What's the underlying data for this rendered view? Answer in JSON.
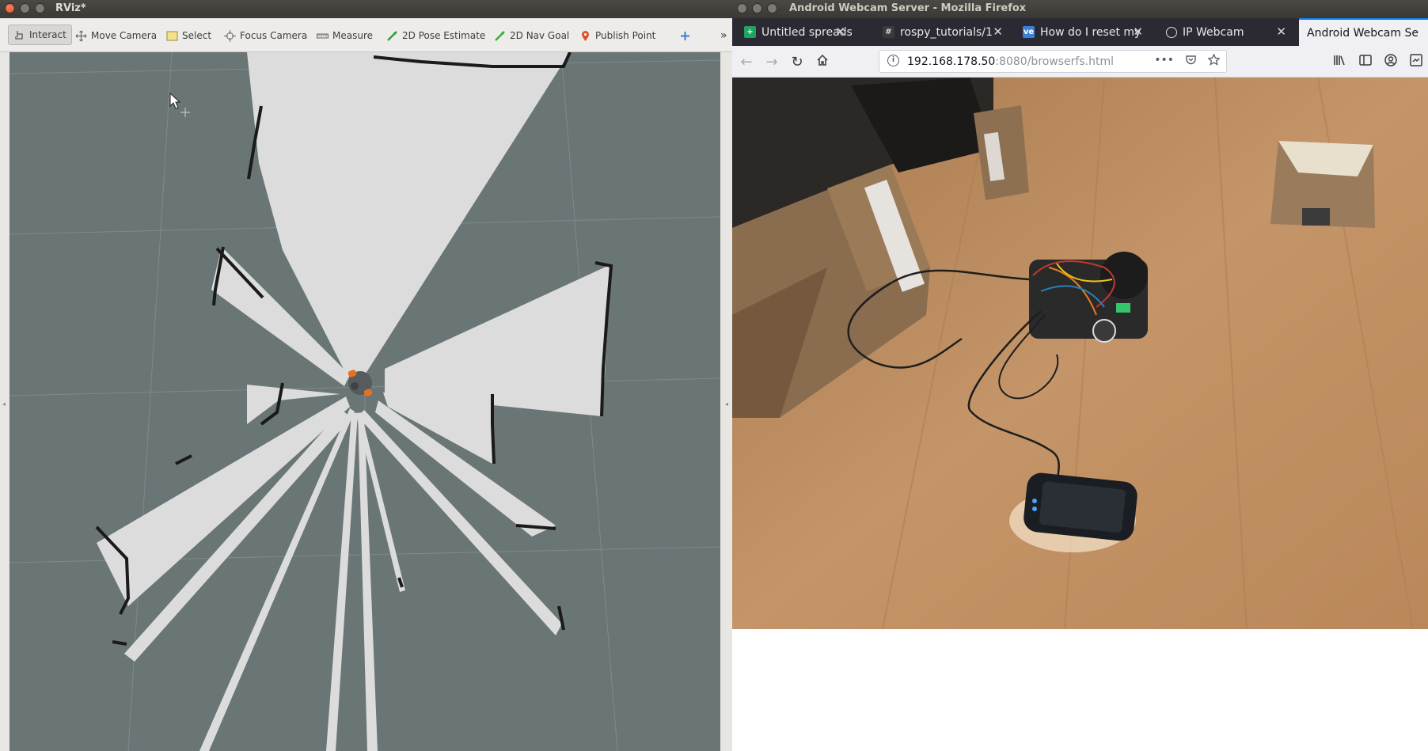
{
  "rviz": {
    "title": "RViz*",
    "tools": [
      {
        "label": "Interact",
        "icon": "interact-icon"
      },
      {
        "label": "Move Camera",
        "icon": "move-camera-icon"
      },
      {
        "label": "Select",
        "icon": "select-icon"
      },
      {
        "label": "Focus Camera",
        "icon": "focus-camera-icon"
      },
      {
        "label": "Measure",
        "icon": "measure-icon"
      },
      {
        "label": "2D Pose Estimate",
        "icon": "pose-estimate-icon"
      },
      {
        "label": "2D Nav Goal",
        "icon": "nav-goal-icon"
      },
      {
        "label": "Publish Point",
        "icon": "publish-point-icon"
      }
    ],
    "active_tool": "Interact",
    "overflow_glyph": "»",
    "colors": {
      "map_unknown": "#6a7576",
      "map_free": "#dcdcdc",
      "map_occupied": "#1a1a1a",
      "robot": "#e8701f"
    }
  },
  "firefox": {
    "title": "Android Webcam Server - Mozilla Firefox",
    "tabs": [
      {
        "title": "Untitled spreadsh",
        "icon": "sheets-icon"
      },
      {
        "title": "rospy_tutorials/1",
        "icon": "github-grid-icon"
      },
      {
        "title": "How do I reset my",
        "icon": "ve-icon"
      },
      {
        "title": "IP Webcam",
        "icon": "webcam-icon"
      },
      {
        "title": "Android Webcam Se",
        "icon": "none",
        "active": true
      }
    ],
    "url_host": "192.168.178.50",
    "url_rest": ":8080/browserfs.html",
    "url_actions": [
      "•••"
    ]
  }
}
